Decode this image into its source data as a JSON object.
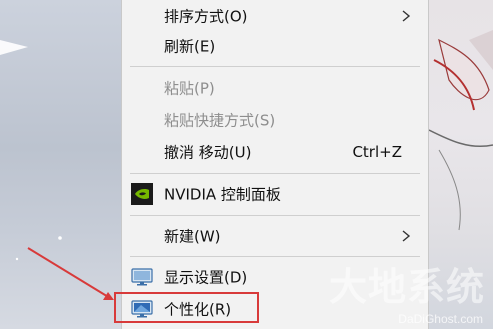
{
  "menu": {
    "sort_by": "排序方式(O)",
    "refresh": "刷新(E)",
    "paste": "粘贴(P)",
    "paste_shortcut": "粘贴快捷方式(S)",
    "undo_move": "撤消 移动(U)",
    "undo_shortcut": "Ctrl+Z",
    "nvidia": "NVIDIA 控制面板",
    "new": "新建(W)",
    "display_settings": "显示设置(D)",
    "personalize": "个性化(R)"
  },
  "icons": {
    "sort_submenu": "chevron-right-icon",
    "new_submenu": "chevron-right-icon",
    "nvidia": "nvidia-logo-icon",
    "display": "monitor-icon",
    "personalize": "personalize-monitor-icon"
  },
  "colors": {
    "highlight": "#d83a3a",
    "arrow": "#d83a3a",
    "nvidia_green": "#76b900"
  },
  "watermark": {
    "main": "大地系统",
    "sub": "DaDiGhost.com"
  }
}
